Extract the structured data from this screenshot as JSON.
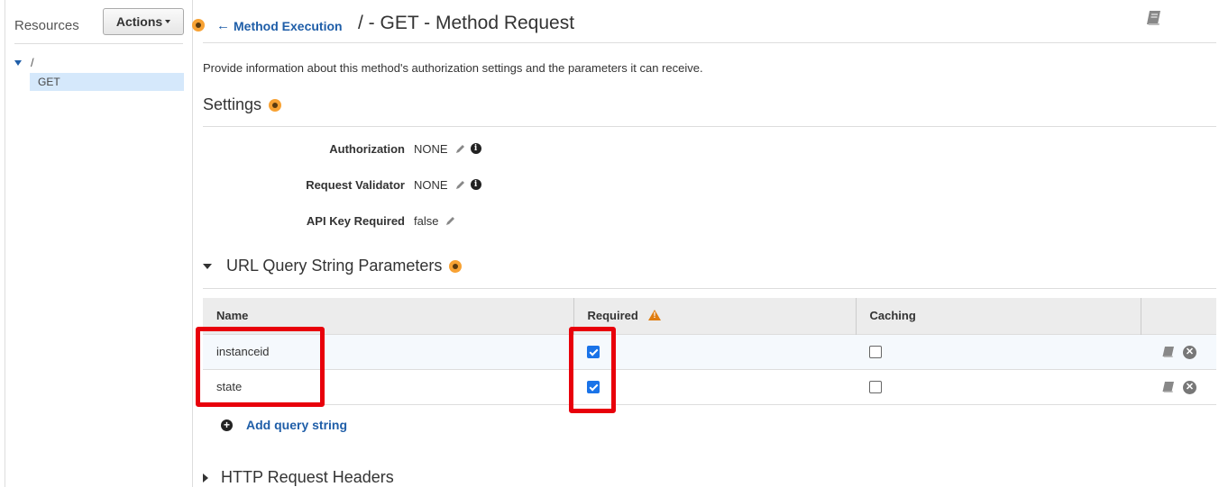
{
  "sidebar": {
    "title": "Resources",
    "actions_label": "Actions",
    "tree": {
      "root": "/",
      "selected_method": "GET"
    }
  },
  "header": {
    "back_label": "Method Execution",
    "title": "/ - GET - Method Request"
  },
  "description": "Provide information about this method's authorization settings and the parameters it can receive.",
  "settings": {
    "heading": "Settings",
    "rows": [
      {
        "label": "Authorization",
        "value": "NONE"
      },
      {
        "label": "Request Validator",
        "value": "NONE"
      },
      {
        "label": "API Key Required",
        "value": "false"
      }
    ]
  },
  "query_params": {
    "heading": "URL Query String Parameters",
    "columns": [
      "Name",
      "Required",
      "Caching"
    ],
    "rows": [
      {
        "name": "instanceid",
        "required": true,
        "caching": false
      },
      {
        "name": "state",
        "required": true,
        "caching": false
      }
    ],
    "add_label": "Add query string"
  },
  "http_headers": {
    "heading": "HTTP Request Headers"
  },
  "colors": {
    "link": "#1f5ea8",
    "help": "#f8a233",
    "highlight": "#e8000b",
    "selected": "#d5e8fb"
  },
  "icons": [
    "book-icon",
    "pencil-icon",
    "info-icon",
    "warning-icon",
    "close-icon",
    "plus-icon",
    "help-icon"
  ]
}
